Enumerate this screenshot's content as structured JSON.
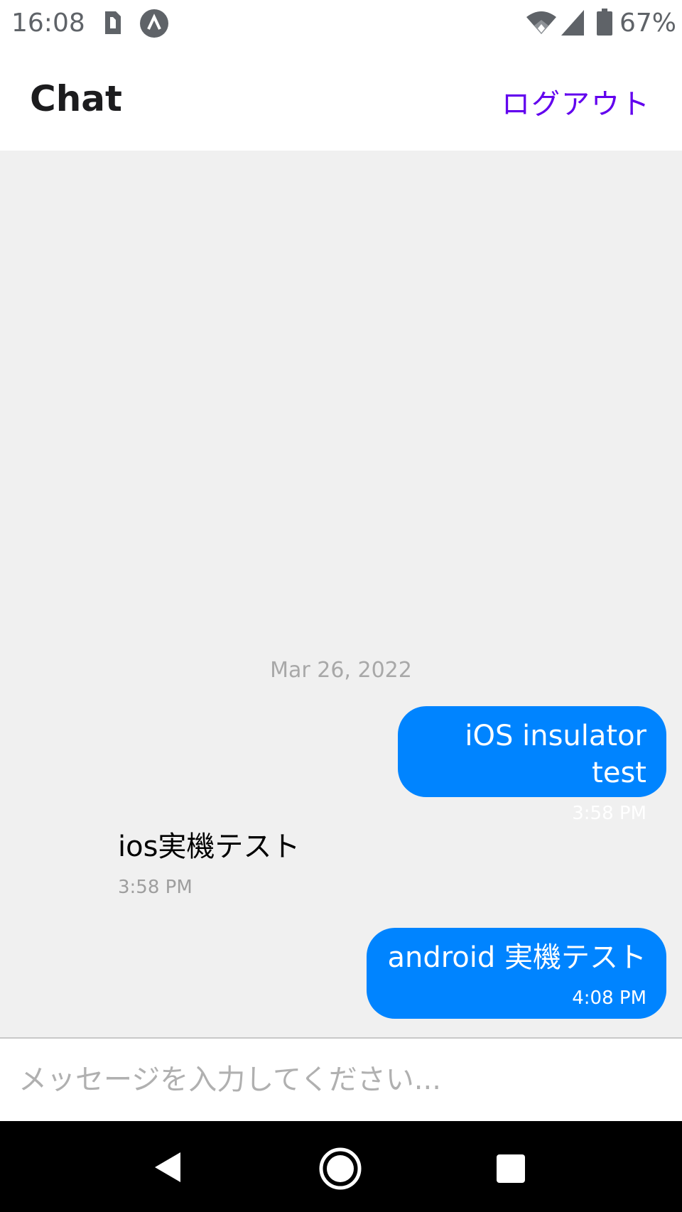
{
  "status_bar": {
    "time": "16:08",
    "battery": "67%",
    "icons": [
      "sim-card-icon",
      "app-notification-icon",
      "wifi-icon",
      "cell-signal-icon",
      "battery-icon"
    ]
  },
  "header": {
    "title": "Chat",
    "logout_label": "ログアウト"
  },
  "chat": {
    "date_separator": "Mar 26, 2022",
    "messages": [
      {
        "direction": "outgoing",
        "text": "iOS insulator test",
        "time": "3:58 PM"
      },
      {
        "direction": "incoming",
        "text": "ios実機テスト",
        "time": "3:58 PM"
      },
      {
        "direction": "outgoing",
        "text": "android 実機テスト",
        "time": "4:08 PM"
      }
    ]
  },
  "composer": {
    "value": "",
    "placeholder": "メッセージを入力してください..."
  },
  "nav_bar": {
    "buttons": [
      "back-icon",
      "home-icon",
      "recents-icon"
    ]
  },
  "colors": {
    "accent": "#6200ee",
    "outgoing_bubble": "#0084ff",
    "chat_background": "#f0f0f0"
  }
}
